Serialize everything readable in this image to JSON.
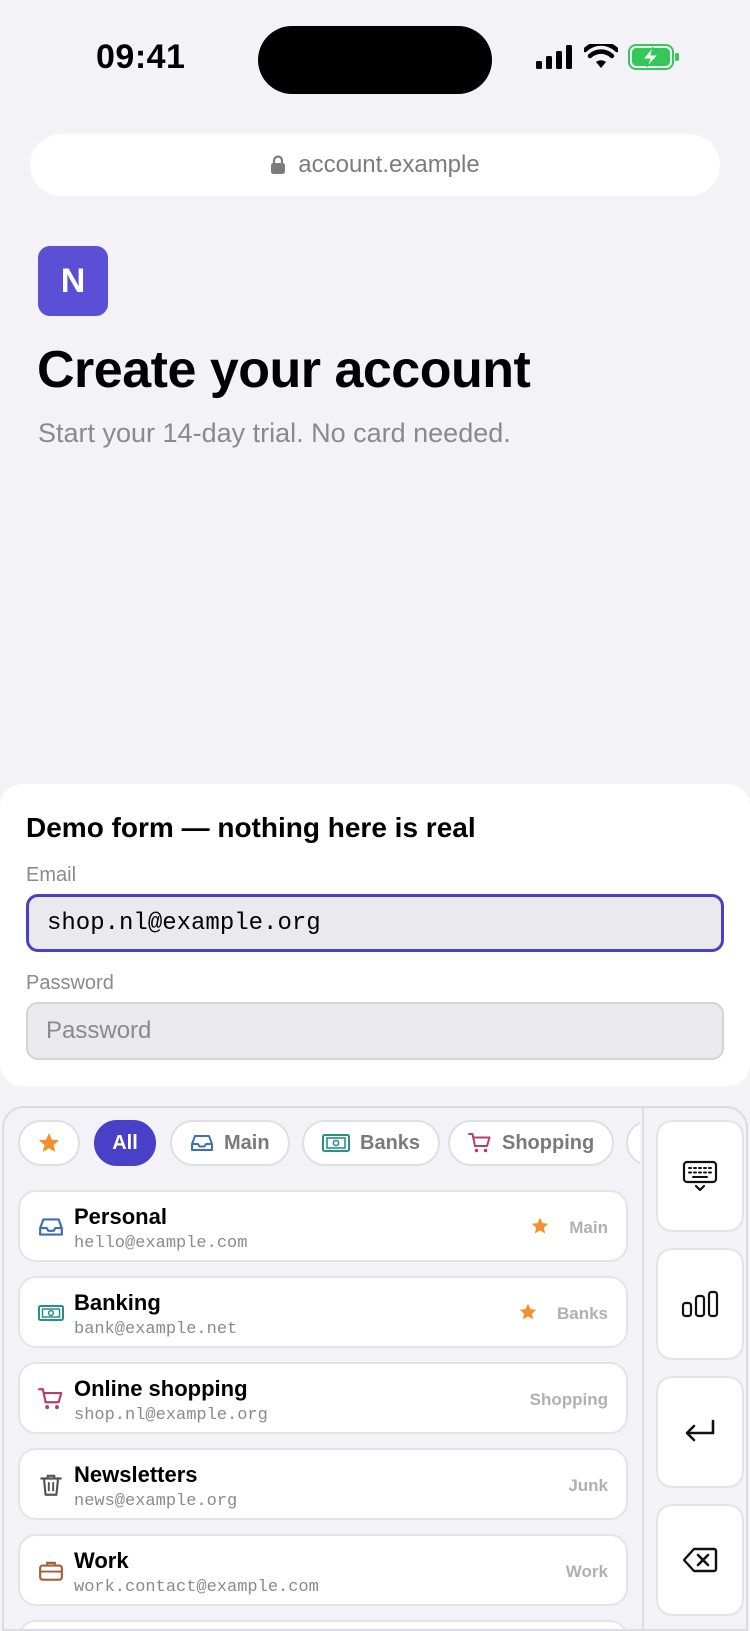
{
  "status_bar": {
    "time": "09:41"
  },
  "browser": {
    "url": "account.example"
  },
  "header": {
    "logo_letter": "N",
    "title": "Create your account",
    "subtitle": "Start your 14-day trial. No card needed."
  },
  "form": {
    "heading": "Demo form — nothing here is real",
    "email_label": "Email",
    "email_value": "shop.nl@example.org",
    "password_label": "Password",
    "password_placeholder": "Password"
  },
  "filters": {
    "all_label": "All",
    "main_label": "Main",
    "banks_label": "Banks",
    "shopping_label": "Shopping",
    "selected": "All"
  },
  "accounts": [
    {
      "name": "Personal",
      "email": "hello@example.com",
      "tag": "Main",
      "starred": true,
      "icon": "inbox-icon"
    },
    {
      "name": "Banking",
      "email": "bank@example.net",
      "tag": "Banks",
      "starred": true,
      "icon": "banknote-icon"
    },
    {
      "name": "Online shopping",
      "email": "shop.nl@example.org",
      "tag": "Shopping",
      "starred": false,
      "icon": "cart-icon"
    },
    {
      "name": "Newsletters",
      "email": "news@example.org",
      "tag": "Junk",
      "starred": false,
      "icon": "trash-icon"
    },
    {
      "name": "Work",
      "email": "work.contact@example.com",
      "tag": "Work",
      "starred": false,
      "icon": "briefcase-icon"
    }
  ],
  "side_keys": [
    "keyboard-hide-icon",
    "bar-chart-icon",
    "return-icon",
    "backspace-icon"
  ],
  "colors": {
    "accent": "#4a3fc7",
    "logo": "#5b4fd6",
    "star": "#f5902a",
    "battery": "#34c759"
  }
}
